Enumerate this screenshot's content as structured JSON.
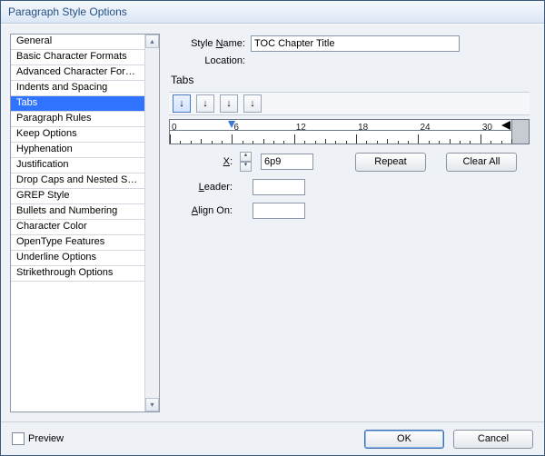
{
  "window": {
    "title": "Paragraph Style Options"
  },
  "sidebar": {
    "selected_index": 4,
    "items": [
      {
        "label": "General"
      },
      {
        "label": "Basic Character Formats"
      },
      {
        "label": "Advanced Character Formats"
      },
      {
        "label": "Indents and Spacing"
      },
      {
        "label": "Tabs"
      },
      {
        "label": "Paragraph Rules"
      },
      {
        "label": "Keep Options"
      },
      {
        "label": "Hyphenation"
      },
      {
        "label": "Justification"
      },
      {
        "label": "Drop Caps and Nested Styles"
      },
      {
        "label": "GREP Style"
      },
      {
        "label": "Bullets and Numbering"
      },
      {
        "label": "Character Color"
      },
      {
        "label": "OpenType Features"
      },
      {
        "label": "Underline Options"
      },
      {
        "label": "Strikethrough Options"
      }
    ]
  },
  "header": {
    "style_name_label": "Style Name:",
    "style_name_value": "TOC Chapter Title",
    "location_label": "Location:"
  },
  "panel": {
    "title": "Tabs",
    "alignment_buttons": [
      {
        "name": "tab-align-left",
        "glyph": "↓",
        "active": true
      },
      {
        "name": "tab-align-center",
        "glyph": "↓",
        "active": false
      },
      {
        "name": "tab-align-right",
        "glyph": "↓",
        "active": false
      },
      {
        "name": "tab-align-decimal",
        "glyph": "↓",
        "active": false
      }
    ],
    "ruler": {
      "major_ticks": [
        0,
        6,
        12,
        18,
        24,
        30
      ],
      "marker_at": 6
    },
    "fields": {
      "x_label": "X:",
      "x_value": "6p9",
      "leader_label": "Leader:",
      "leader_value": "",
      "align_on_label": "Align On:",
      "align_on_value": ""
    },
    "buttons": {
      "repeat": "Repeat",
      "clear_all": "Clear All"
    }
  },
  "footer": {
    "preview_label": "Preview",
    "preview_checked": false,
    "ok": "OK",
    "cancel": "Cancel"
  }
}
